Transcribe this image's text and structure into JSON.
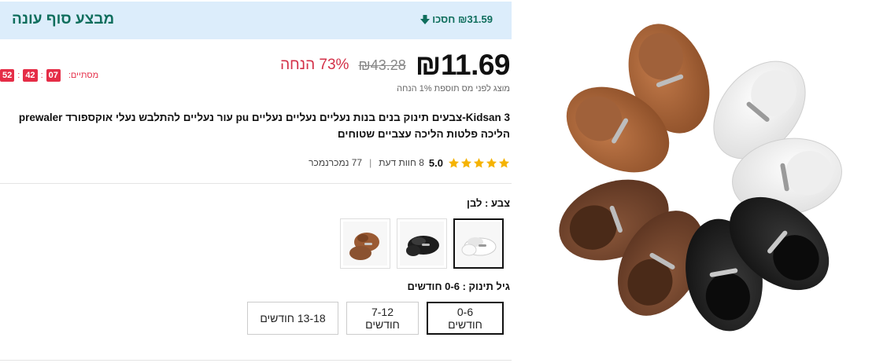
{
  "deal": {
    "title": "מבצע סוף עונה",
    "save_text": "₪31.59 חסכו",
    "accent_color": "#0f6e5d",
    "banner_color": "#dcedfb"
  },
  "countdown": {
    "label": "מסתיים:",
    "hours": "07",
    "minutes": "42",
    "seconds": "52"
  },
  "price": {
    "current": "₪11.69",
    "original": "₪43.28",
    "discount": "73% הנחה",
    "tax_note": "מוצג לפני מס תוספת 1% הנחה"
  },
  "product": {
    "title": "3 Kidsan-צבעים תינוק בנים בנות נעליים נעליים נעליים pu עור נעליים להתלבש נעלי אוקספורד prewaler הליכה פלטות הליכה עצביים שטוחים"
  },
  "rating": {
    "stars": 5,
    "value": "5.0",
    "reviews": "8 חוות דעת",
    "separator": "|",
    "sold": "77 נמכרנמכר"
  },
  "color": {
    "label": "צבע : לבן",
    "options": [
      {
        "name": "white-shoe-swatch",
        "color": "#f2f2f2"
      },
      {
        "name": "black-shoe-swatch",
        "color": "#1c1c1c"
      },
      {
        "name": "brown-shoe-swatch",
        "color": "#9a5a33"
      }
    ]
  },
  "age": {
    "label": "גיל תינוק : 0-6 חודשים",
    "options": [
      "0-6 חודשים",
      "7-12 חודשים",
      "13-18 חודשים"
    ],
    "selected": "0-6 חודשים"
  }
}
